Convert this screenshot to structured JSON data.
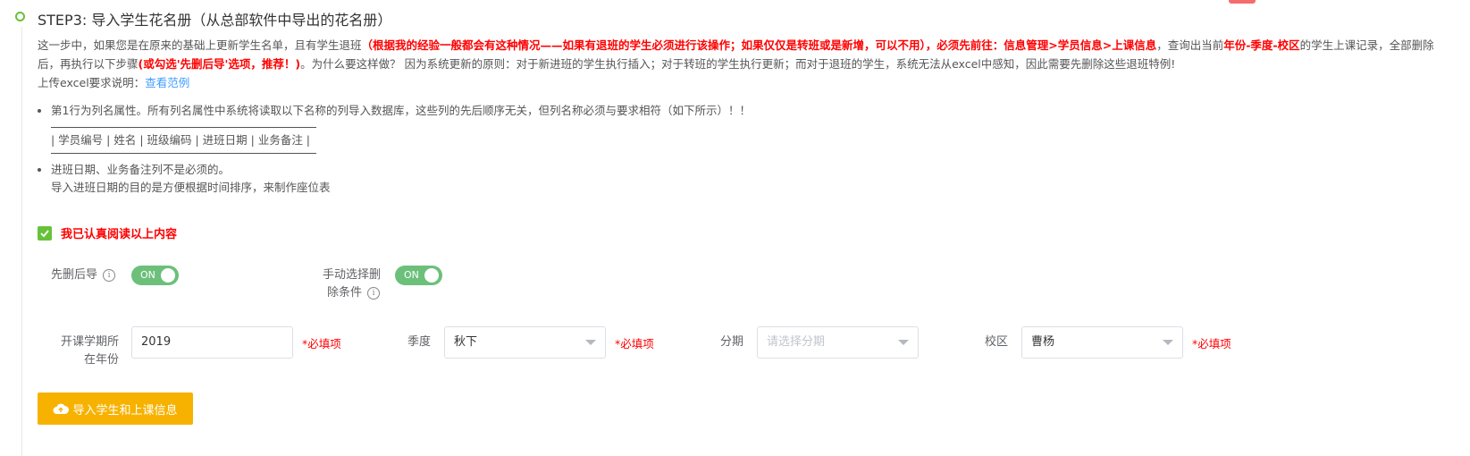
{
  "step": {
    "title": "STEP3: 导入学生花名册（从总部软件中导出的花名册）"
  },
  "description": {
    "p1": "这一步中，如果您是在原来的基础上更新学生名单，且有学生退班",
    "red1": "（根据我的经验一般都会有这种情况——如果有退班的学生必须进行该操作；如果仅仅是转班或是新增，可以不用），必须先前往：信息管理>学员信息>上课信息",
    "p2": "，查询出当前",
    "red2": "年份-季度-校区",
    "p3": "的学生上课记录，全部删除后，再执行以下步骤",
    "red3": "(或勾选'先删后导'选项，推荐！)",
    "p4": "。为什么要这样做？ 因为系统更新的原则：对于新进班的学生执行插入；对于转班的学生执行更新；而对于退班的学生，系统无法从excel中感知，因此需要先删除这些退班特例!",
    "p5": "上传excel要求说明：",
    "link": "查看范例"
  },
  "rules": {
    "item1": "第1行为列名属性。所有列名属性中系统将读取以下名称的列导入数据库，这些列的先后顺序无关，但列名称必须与要求相符（如下所示）！！",
    "columns": "| 学员编号 | 姓名 | 班级编码 | 进班日期 | 业务备注 |",
    "item2": "进班日期、业务备注列不是必须的。",
    "item2_sub": "导入进班日期的目的是方便根据时间排序，来制作座位表"
  },
  "confirm": {
    "label": "我已认真阅读以上内容",
    "checked": true
  },
  "switches": {
    "delete_first": {
      "label": "先删后导",
      "state": "ON"
    },
    "manual_select": {
      "label1": "手动选择删",
      "label2": "除条件",
      "state": "ON"
    }
  },
  "form": {
    "year": {
      "label1": "开课学期所",
      "label2": "在年份",
      "value": "2019",
      "required": "*必填项"
    },
    "season": {
      "label": "季度",
      "value": "秋下",
      "required": "*必填项"
    },
    "period": {
      "label": "分期",
      "placeholder": "请选择分期"
    },
    "campus": {
      "label": "校区",
      "value": "曹杨",
      "required": "*必填项"
    }
  },
  "import_button": {
    "label": "导入学生和上课信息"
  },
  "colors": {
    "accent_green": "#67c23a",
    "switch_green": "#6cc07a",
    "warning_red": "#ff0000",
    "link_blue": "#409eff",
    "button_orange": "#f7b200"
  },
  "icons": [
    "info-icon",
    "check-icon",
    "cloud-upload-icon",
    "chevron-down-icon"
  ]
}
